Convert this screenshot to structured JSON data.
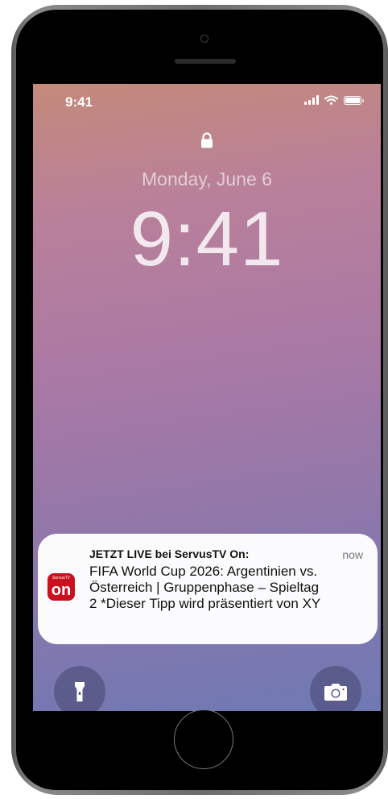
{
  "status_bar": {
    "time": "9:41",
    "signal_icon": "cellular-signal-icon",
    "wifi_icon": "wifi-icon",
    "battery_icon": "battery-icon"
  },
  "lock_screen": {
    "lock_icon": "lock-icon",
    "date": "Monday, June 6",
    "time": "9:41"
  },
  "notification": {
    "app_icon_text": "on",
    "app_icon_small_text": "ServusTV",
    "app_icon_color": "#c8101e",
    "title": "JETZT LIVE bei ServusTV On:",
    "timestamp": "now",
    "body": "FIFA World Cup 2026: Argentinien vs. Österreich | Gruppenphase – Spieltag 2 *Dieser Tipp wird präsentiert von XY"
  },
  "quick_actions": {
    "flashlight_icon": "flashlight-icon",
    "camera_icon": "camera-icon"
  }
}
